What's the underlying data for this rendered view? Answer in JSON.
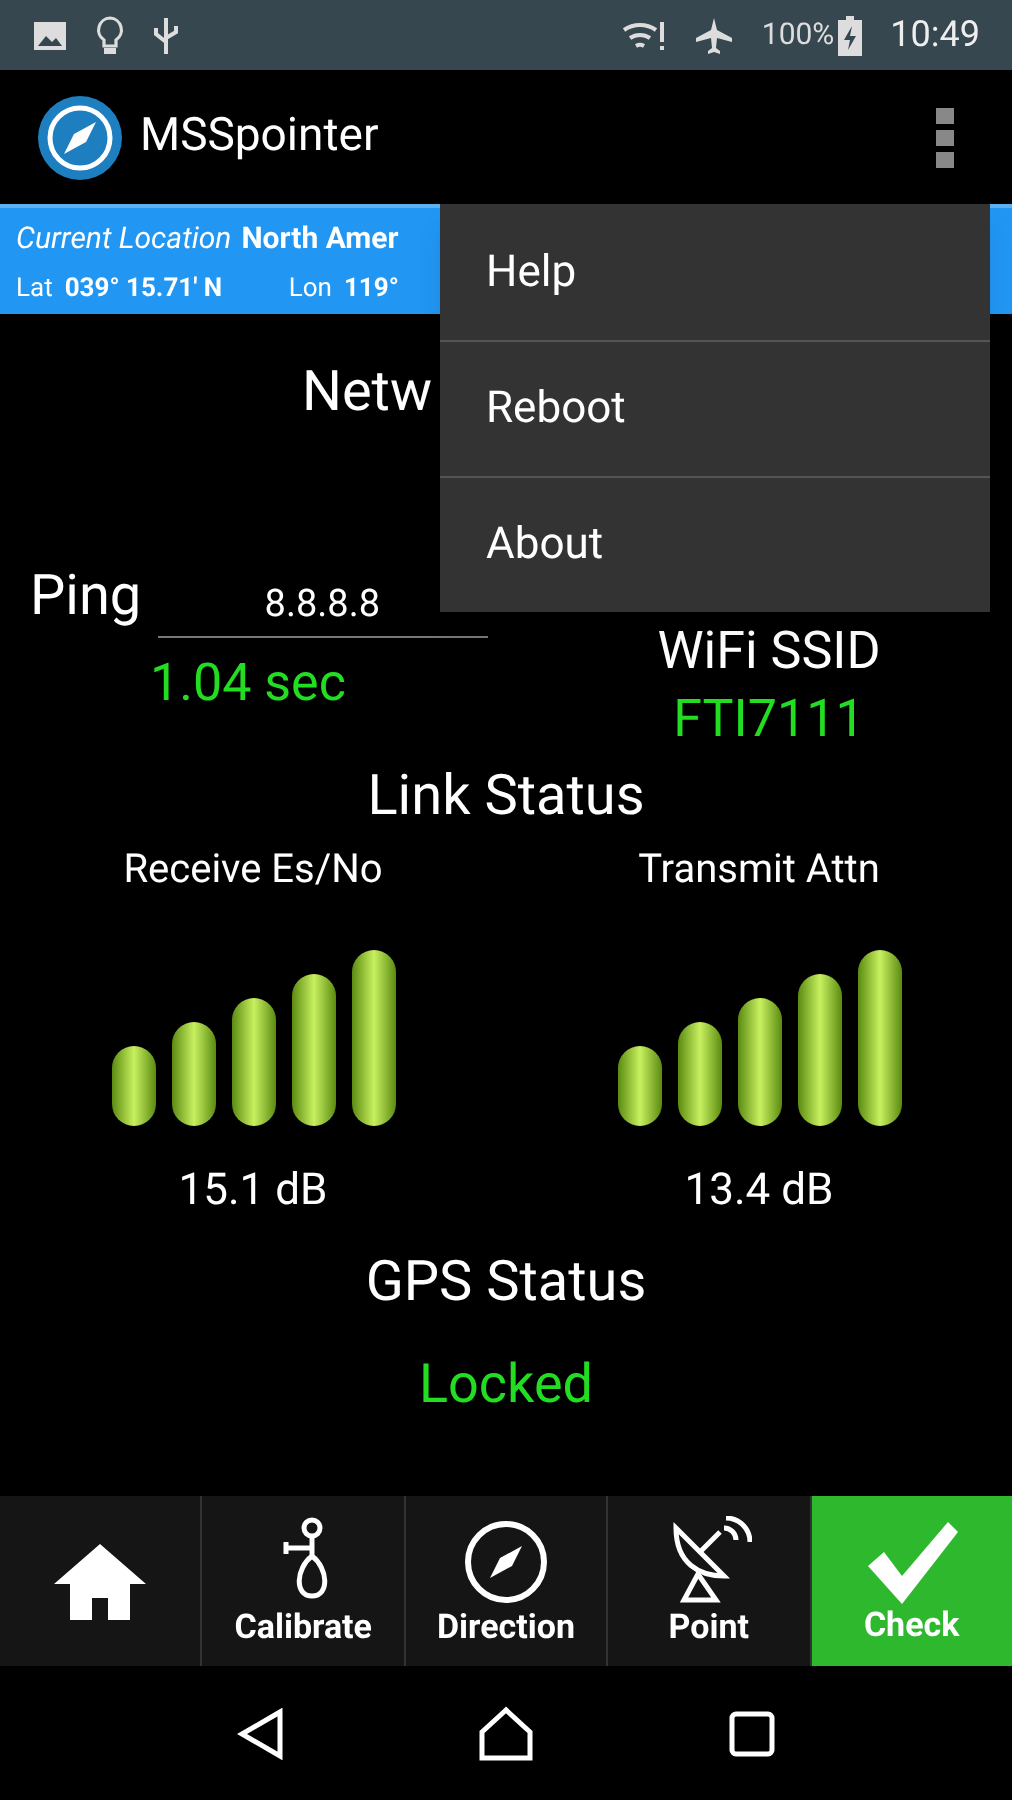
{
  "status_bar": {
    "battery": "100%",
    "time": "10:49"
  },
  "app_bar": {
    "title": "MSSpointer"
  },
  "location_bar": {
    "label": "Current Location",
    "region": "North Amer",
    "lat_label": "Lat",
    "lat": "039° 15.71' N",
    "lon_label": "Lon",
    "lon": "119°"
  },
  "network": {
    "title": "Netw"
  },
  "ping": {
    "label": "Ping",
    "host": "8.8.8.8",
    "result": "1.04 sec"
  },
  "wifi": {
    "label": "WiFi SSID",
    "ssid": "FTI7111"
  },
  "link_status": {
    "title": "Link Status",
    "meters": [
      {
        "label": "Receive Es/No",
        "level": 1,
        "reading": "15.1 dB"
      },
      {
        "label": "Transmit Attn",
        "level": 1,
        "reading": "13.4 dB"
      }
    ]
  },
  "gps": {
    "title": "GPS Status",
    "status": "Locked"
  },
  "menu": [
    {
      "label": "Help"
    },
    {
      "label": "Reboot"
    },
    {
      "label": "About"
    }
  ],
  "bottom_nav": [
    {
      "kind": "home",
      "selected": false
    },
    {
      "kind": "calibrate",
      "label": "Calibrate",
      "selected": false
    },
    {
      "kind": "direction",
      "label": "Direction",
      "selected": false
    },
    {
      "kind": "point",
      "label": "Point",
      "selected": false
    },
    {
      "kind": "check",
      "label": "Check",
      "selected": true
    }
  ]
}
